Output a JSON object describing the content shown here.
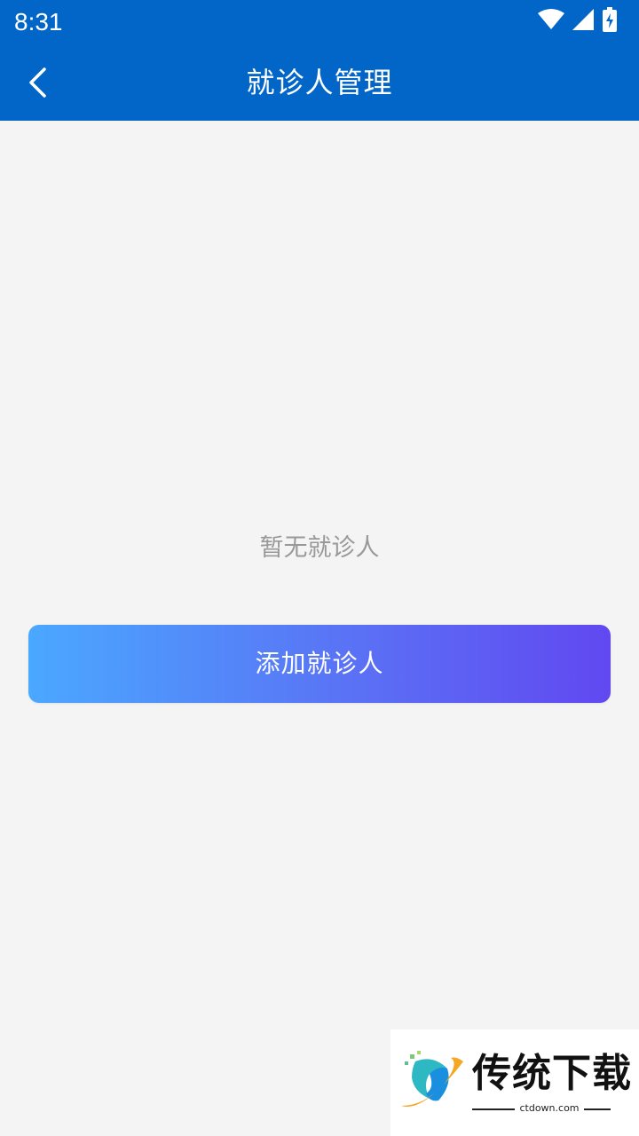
{
  "status_bar": {
    "time": "8:31",
    "icons": [
      "wifi-icon",
      "cellular-signal-icon",
      "battery-charging-icon"
    ]
  },
  "header": {
    "title": "就诊人管理",
    "back_icon": "chevron-left-icon",
    "background_color": "#0266c9"
  },
  "main": {
    "empty_text": "暂无就诊人",
    "add_button_label": "添加就诊人",
    "button_gradient": [
      "#4aa8ff",
      "#6148f1"
    ],
    "background_color": "#f4f4f4"
  },
  "watermark": {
    "name": "传统下载",
    "domain": "ctdown.com"
  }
}
